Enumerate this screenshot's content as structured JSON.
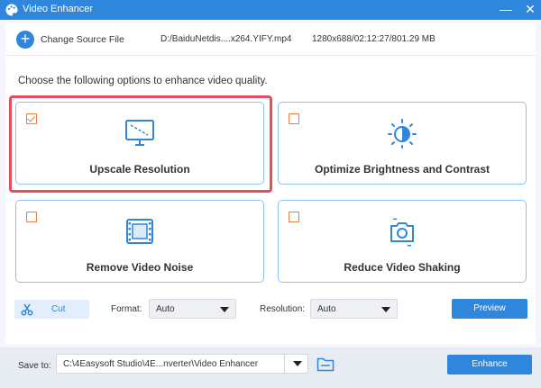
{
  "window": {
    "title": "Video Enhancer",
    "app_icon": "palette-icon",
    "minimize_label": "—",
    "close_label": "✕"
  },
  "source": {
    "change_label": "Change Source File",
    "file_path": "D:/BaiduNetdis....x264.YIFY.mp4",
    "file_info": "1280x688/02:12:27/801.29 MB"
  },
  "intro_text": "Choose the following options to enhance video quality.",
  "options": [
    {
      "label": "Upscale Resolution",
      "checked": true,
      "icon": "monitor-upscale-icon"
    },
    {
      "label": "Optimize Brightness and Contrast",
      "checked": false,
      "icon": "brightness-icon"
    },
    {
      "label": "Remove Video Noise",
      "checked": false,
      "icon": "film-noise-icon"
    },
    {
      "label": "Reduce Video Shaking",
      "checked": false,
      "icon": "camera-stabilize-icon"
    }
  ],
  "controls": {
    "cut_label": "Cut",
    "format_label": "Format:",
    "format_value": "Auto",
    "resolution_label": "Resolution:",
    "resolution_value": "Auto",
    "preview_label": "Preview"
  },
  "footer": {
    "save_label": "Save to:",
    "save_path": "C:\\4Easysoft Studio\\4E...nverter\\Video Enhancer",
    "enhance_label": "Enhance"
  },
  "colors": {
    "accent": "#2f86dd",
    "checkbox": "#f07a3a",
    "highlight": "#e94a5c",
    "card_border": "#8fc1ef"
  }
}
